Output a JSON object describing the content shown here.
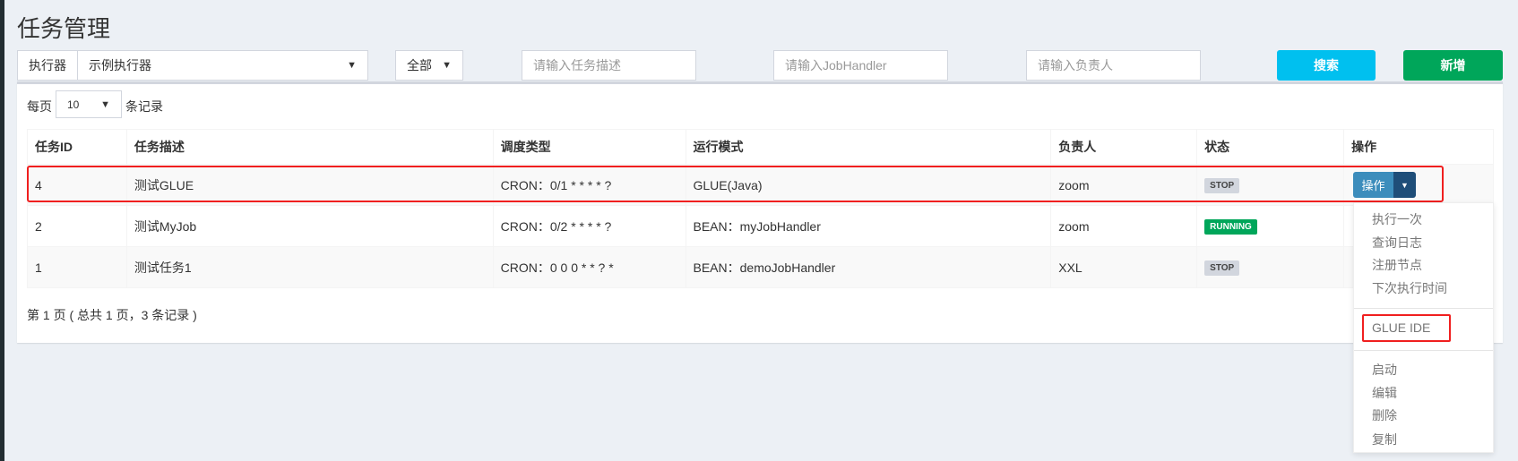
{
  "page_title": "任务管理",
  "filters": {
    "executor_label": "执行器",
    "executor_value": "示例执行器",
    "status_value": "全部",
    "desc_placeholder": "请输入任务描述",
    "handler_placeholder": "请输入JobHandler",
    "author_placeholder": "请输入负责人",
    "search_label": "搜索",
    "add_label": "新增"
  },
  "page_size": {
    "prefix": "每页",
    "value": "10",
    "suffix": "条记录"
  },
  "table": {
    "headers": [
      "任务ID",
      "任务描述",
      "调度类型",
      "运行模式",
      "负责人",
      "状态",
      "操作"
    ],
    "rows": [
      {
        "id": "4",
        "desc": "测试GLUE",
        "schedule": "CRON：0/1 * * * * ?",
        "mode": "GLUE(Java)",
        "author": "zoom",
        "status": "STOP"
      },
      {
        "id": "2",
        "desc": "测试MyJob",
        "schedule": "CRON：0/2 * * * * ?",
        "mode": "BEAN：myJobHandler",
        "author": "zoom",
        "status": "RUNNING"
      },
      {
        "id": "1",
        "desc": "测试任务1",
        "schedule": "CRON：0 0 0 * * ? *",
        "mode": "BEAN：demoJobHandler",
        "author": "XXL",
        "status": "STOP"
      }
    ]
  },
  "action_button": "操作",
  "action_menu": [
    "执行一次",
    "查询日志",
    "注册节点",
    "下次执行时间",
    "GLUE IDE",
    "启动",
    "编辑",
    "删除",
    "复制"
  ],
  "pagination": "第 1 页 ( 总共 1 页，3 条记录 )",
  "colors": {
    "search": "#00c0ef",
    "add": "#00a65a",
    "action": "#3c8dbc",
    "running": "#00a65a",
    "highlight": "#f01f1f"
  }
}
